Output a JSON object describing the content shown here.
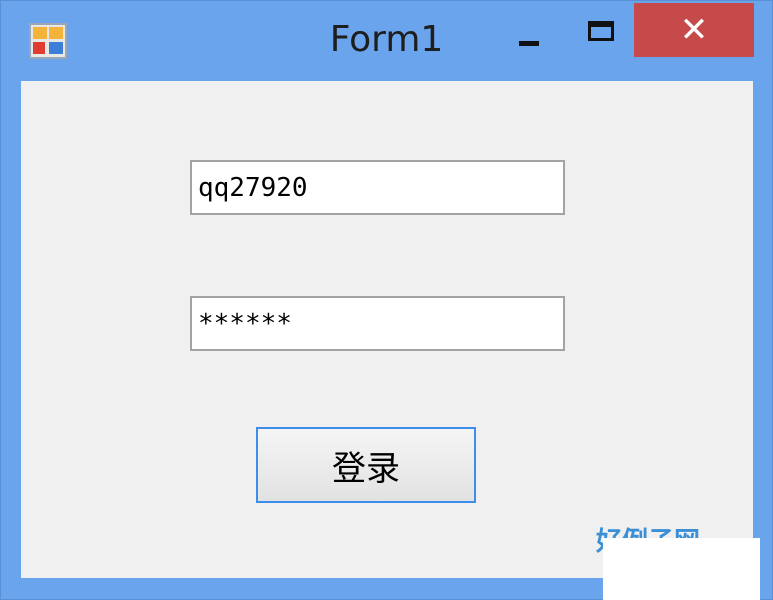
{
  "window": {
    "title": "Form1",
    "close_glyph": "✕"
  },
  "form": {
    "username_value": "qq27920",
    "password_value": "******",
    "login_label": "登录"
  },
  "watermark": {
    "text": "好例子网"
  },
  "colors": {
    "frame": "#6aa4ec",
    "client_bg": "#f0f0f0",
    "close_button": "#c74a4a",
    "button_focus_border": "#3d8ee8"
  },
  "icons": {
    "app": "winforms-app-icon",
    "minimize": "minimize-icon",
    "maximize": "maximize-icon",
    "close": "close-icon"
  }
}
